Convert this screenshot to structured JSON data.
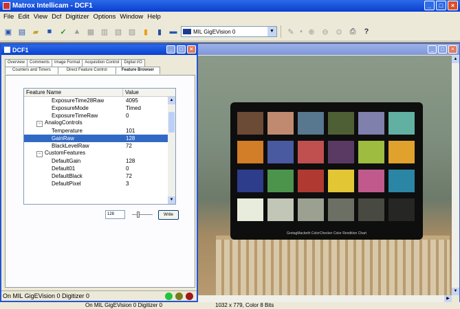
{
  "app": {
    "title": "Matrox Intellicam - DCF1"
  },
  "menu": [
    "File",
    "Edit",
    "View",
    "Dcf",
    "Digitizer",
    "Options",
    "Window",
    "Help"
  ],
  "toolbar": {
    "combo_value": "MIL GigEVision 0"
  },
  "dcf_window": {
    "title": "DCF1",
    "tabs_row1": [
      "Overview",
      "Comments",
      "Image Format",
      "Acquisition Control",
      "Digital I/O"
    ],
    "tabs_row2": [
      "Counters and Timers",
      "Direct Feature Control",
      "Feature Browser"
    ],
    "grid": {
      "col_name": "Feature Name",
      "col_value": "Value",
      "rows": [
        {
          "name": "ExposureTime28Raw",
          "value": "4095"
        },
        {
          "name": "ExposureMode",
          "value": "Timed"
        },
        {
          "name": "ExposureTimeRaw",
          "value": "0"
        },
        {
          "name": "AnalogControls",
          "value": ""
        },
        {
          "name": "Temperature",
          "value": "101"
        },
        {
          "name": "GainRaw",
          "value": "128"
        },
        {
          "name": "BlackLevelRaw",
          "value": "72"
        },
        {
          "name": "CustomFeatures",
          "value": ""
        },
        {
          "name": "DefaultGain",
          "value": "128"
        },
        {
          "name": "Default01",
          "value": "0"
        },
        {
          "name": "DefaultBlack",
          "value": "72"
        },
        {
          "name": "DefaultPixel",
          "value": "3"
        }
      ],
      "selected_row": "GainRaw"
    },
    "value_box": "128",
    "write_label": "Write",
    "status_text": "On MIL GigEVision 0 Digitizer 0"
  },
  "image_window": {
    "colorchecker_label": "GretagMacbeth ColorChecker Color Rendition Chart"
  },
  "statusbar": {
    "digitizer": "On MIL GigEVision 0 Digitizer 0",
    "image_info": "1032 x 779, Color 8 Bits"
  },
  "colors": {
    "title_blue": "#0a3fcf",
    "selected_row": "#316ac5",
    "led_green": "#22c33a",
    "led_olive": "#7a7a1e",
    "led_red": "#a01818"
  }
}
